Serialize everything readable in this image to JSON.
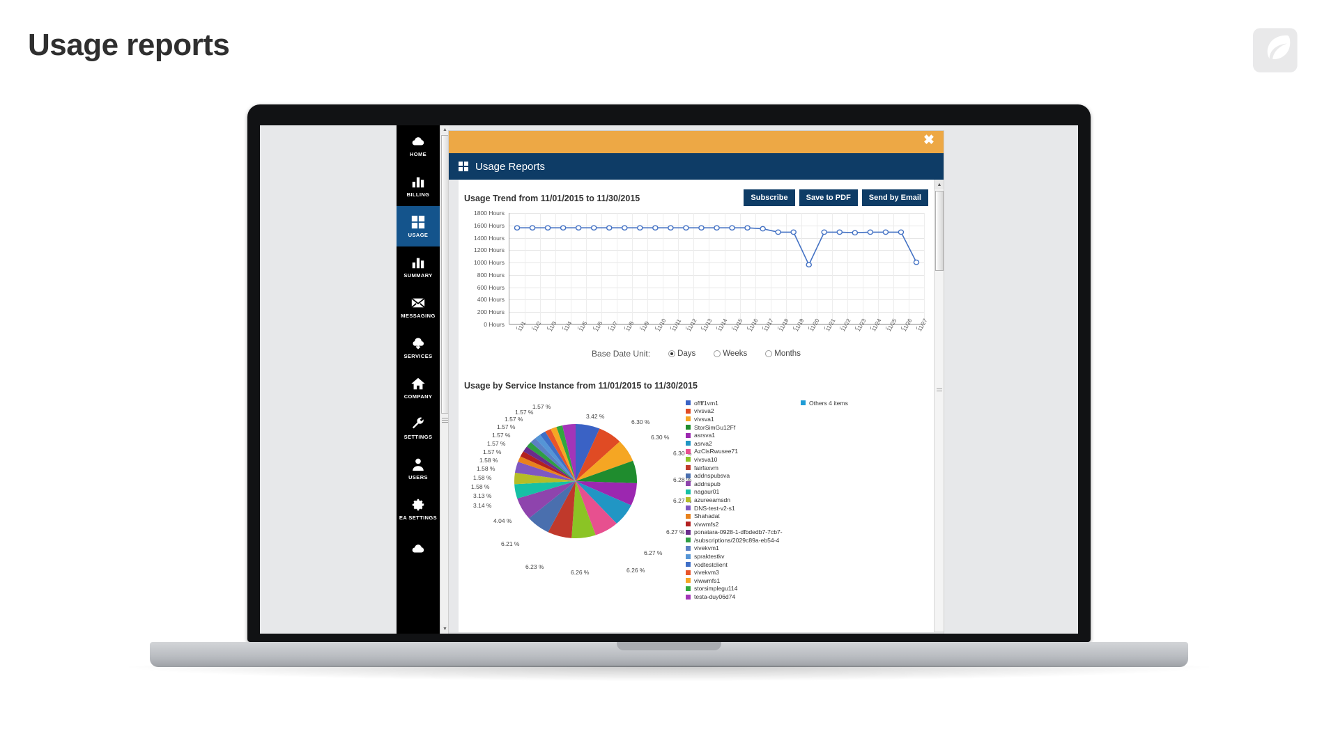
{
  "page": {
    "title": "Usage reports",
    "logo_name": "leaf-logo"
  },
  "app": {
    "sidebar": {
      "items": [
        {
          "label": "HOME",
          "icon": "cloud-icon",
          "active": false
        },
        {
          "label": "BILLING",
          "icon": "bar-chart-icon",
          "active": false
        },
        {
          "label": "USAGE",
          "icon": "grid-icon",
          "active": true
        },
        {
          "label": "SUMMARY",
          "icon": "bar-chart-icon",
          "active": false
        },
        {
          "label": "MESSAGING",
          "icon": "envelope-icon",
          "active": false
        },
        {
          "label": "SERVICES",
          "icon": "cloud-download-icon",
          "active": false
        },
        {
          "label": "COMPANY",
          "icon": "home-icon",
          "active": false
        },
        {
          "label": "SETTINGS",
          "icon": "wrench-icon",
          "active": false
        },
        {
          "label": "USERS",
          "icon": "user-icon",
          "active": false
        },
        {
          "label": "EA SETTINGS",
          "icon": "gear-icon",
          "active": false
        }
      ]
    }
  },
  "modal": {
    "title": "Usage Reports",
    "close_label": "✖",
    "trend": {
      "title": "Usage Trend from 11/01/2015 to 11/30/2015",
      "buttons": [
        {
          "label": "Subscribe",
          "name": "subscribe-button"
        },
        {
          "label": "Save to PDF",
          "name": "save-to-pdf-button"
        },
        {
          "label": "Send by Email",
          "name": "send-by-email-button"
        }
      ]
    },
    "base_date_unit": {
      "label": "Base Date Unit:",
      "options": [
        {
          "label": "Days",
          "selected": true
        },
        {
          "label": "Weeks",
          "selected": false
        },
        {
          "label": "Months",
          "selected": false
        }
      ]
    },
    "pie": {
      "title": "Usage by Service Instance from 11/01/2015 to 11/30/2015"
    }
  },
  "chart_data": [
    {
      "type": "line",
      "title": "Usage Trend from 11/01/2015 to 11/30/2015",
      "xlabel": "",
      "ylabel": "Hours",
      "ylim": [
        0,
        1800
      ],
      "ytick_labels": [
        "0 Hours",
        "200 Hours",
        "400 Hours",
        "600 Hours",
        "800 Hours",
        "1000 Hours",
        "1200 Hours",
        "1400 Hours",
        "1600 Hours",
        "1800 Hours"
      ],
      "ytick_values": [
        0,
        200,
        400,
        600,
        800,
        1000,
        1200,
        1400,
        1600,
        1800
      ],
      "grid": true,
      "legend_position": "none",
      "series_color": "#4472c4",
      "categories": [
        "11/1",
        "11/2",
        "11/3",
        "11/4",
        "11/5",
        "11/6",
        "11/7",
        "11/8",
        "11/9",
        "11/10",
        "11/11",
        "11/12",
        "11/13",
        "11/14",
        "11/15",
        "11/16",
        "11/17",
        "11/18",
        "11/19",
        "11/20",
        "11/21",
        "11/22",
        "11/23",
        "11/24",
        "11/25",
        "11/26",
        "11/27"
      ],
      "values": [
        1560,
        1560,
        1560,
        1560,
        1560,
        1560,
        1560,
        1560,
        1560,
        1560,
        1560,
        1560,
        1560,
        1560,
        1560,
        1560,
        1545,
        1490,
        1490,
        960,
        1490,
        1490,
        1480,
        1490,
        1490,
        1490,
        1000
      ]
    },
    {
      "type": "pie",
      "title": "Usage by Service Instance from 11/01/2015 to 11/30/2015",
      "legend_position": "right",
      "others_label": "Others 4 items",
      "others_color": "#1f9cd6",
      "labels": [
        "offff1vm1",
        "vivsva2",
        "vivsva1",
        "StorSimGu12Ff",
        "asrsva1",
        "asrva2",
        "AzCisRwusee71",
        "vivsva10",
        "fairfaxvm",
        "addnspubsva",
        "addnspub",
        "nagaur01",
        "azureeamsdn",
        "DNS-test-v2-s1",
        "Shahadat",
        "vivwmfs2",
        "ponatara-0928-1-dfbdedb7-7cb7-",
        "/subscriptions/2029c89a-eb54-4",
        "vivekvm1",
        "spraktestkv",
        "vodtestclient",
        "vivekvm3",
        "viwwmfs1",
        "storsimplegu114",
        "testa-duy06d74"
      ],
      "colors": [
        "#3a62c5",
        "#e04b24",
        "#f5a623",
        "#1f8c2e",
        "#9c27b0",
        "#2196c4",
        "#e7508f",
        "#8bc425",
        "#c0392b",
        "#4a6fae",
        "#8e44ad",
        "#16c0a5",
        "#b5bd27",
        "#7e57c2",
        "#e8821e",
        "#b32020",
        "#6a2c8c",
        "#2f9e44",
        "#5b7fc4",
        "#5595d6",
        "#3f6fc7",
        "#e8542a",
        "#f6a623",
        "#31a83d",
        "#a335b8"
      ],
      "values_percent": [
        6.3,
        6.3,
        6.3,
        6.28,
        6.27,
        6.27,
        6.27,
        6.26,
        6.26,
        6.23,
        6.21,
        4.04,
        3.14,
        3.13,
        1.58,
        1.58,
        1.58,
        1.58,
        1.57,
        1.57,
        1.57,
        1.57,
        1.57,
        1.57,
        3.42
      ],
      "visible_percent_labels": [
        "3.42 %",
        "6.30 %",
        "6.30 %",
        "6.30 %",
        "6.28 %",
        "6.27 %",
        "6.27 %",
        "6.27 %",
        "6.26 %",
        "6.26 %",
        "6.23 %",
        "6.21 %",
        "4.04 %",
        "3.14 %",
        "3.13 %",
        "1.58 %",
        "1.58 %",
        "1.58 %",
        "1.58 %",
        "1.57 %",
        "1.57 %",
        "1.57 %",
        "1.57 %",
        "1.57 %",
        "1.57 %",
        "1.57 %"
      ]
    }
  ]
}
